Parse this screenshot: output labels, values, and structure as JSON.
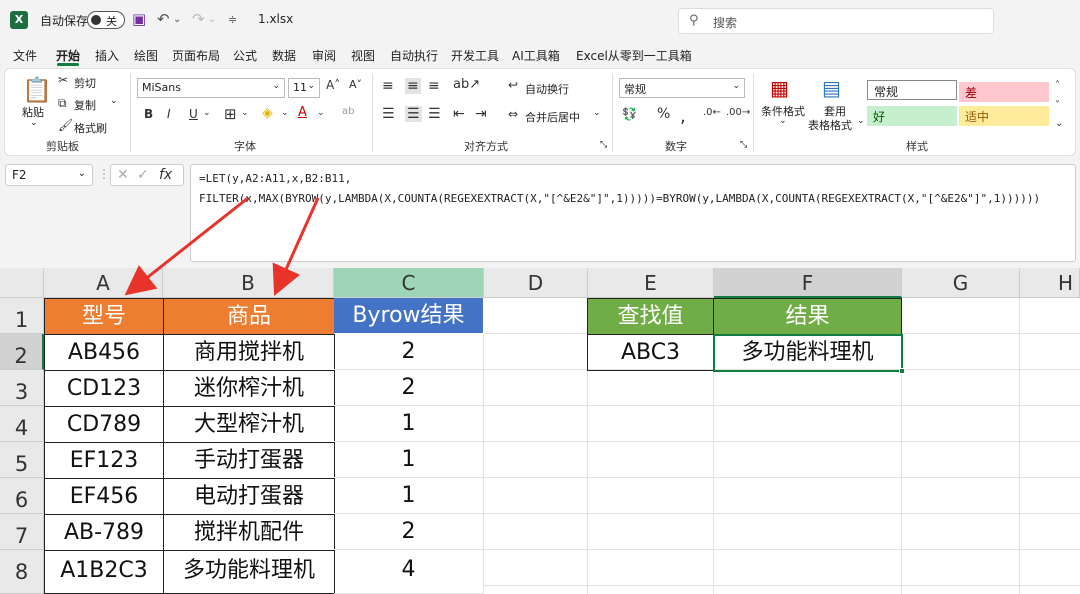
{
  "titlebar": {
    "autosave_label": "自动保存",
    "autosave_state": "关",
    "filename": "1.xlsx",
    "search_placeholder": "搜索"
  },
  "menu": [
    "文件",
    "开始",
    "插入",
    "绘图",
    "页面布局",
    "公式",
    "数据",
    "审阅",
    "视图",
    "自动执行",
    "开发工具",
    "AI工具箱",
    "Excel从零到一工具箱"
  ],
  "ribbon": {
    "clipboard": {
      "paste": "粘贴",
      "cut": "剪切",
      "copy": "复制",
      "format_painter": "格式刷",
      "group": "剪贴板"
    },
    "font": {
      "name": "MiSans",
      "size": "11",
      "group": "字体"
    },
    "alignment": {
      "wrap": "自动换行",
      "merge": "合并后居中",
      "group": "对齐方式"
    },
    "number": {
      "format": "常规",
      "group": "数字"
    },
    "styles": {
      "conditional": "条件格式",
      "table_line1": "套用",
      "table_line2": "表格格式",
      "normal": "常规",
      "bad": "差",
      "good": "好",
      "neutral": "适中",
      "group": "样式"
    }
  },
  "namebox": "F2",
  "formula_line1": "=LET(y,A2:A11,x,B2:B11,",
  "formula_line2": "FILTER(x,MAX(BYROW(y,LAMBDA(X,COUNTA(REGEXEXTRACT(X,\"[^&E2&\"]\",1)))))=BYROW(y,LAMBDA(X,COUNTA(REGEXEXTRACT(X,\"[^&E2&\"]\",1))))))",
  "columns": [
    "A",
    "B",
    "C",
    "D",
    "E",
    "F",
    "G",
    "H"
  ],
  "rows": [
    "1",
    "2",
    "3",
    "4",
    "5",
    "6",
    "7",
    "8"
  ],
  "table": {
    "headers": [
      "型号",
      "商品",
      "Byrow结果"
    ],
    "rows": [
      [
        "AB456",
        "商用搅拌机",
        "2"
      ],
      [
        "CD123",
        "迷你榨汁机",
        "2"
      ],
      [
        "CD789",
        "大型榨汁机",
        "1"
      ],
      [
        "EF123",
        "手动打蛋器",
        "1"
      ],
      [
        "EF456",
        "电动打蛋器",
        "1"
      ],
      [
        "AB-789",
        "搅拌机配件",
        "2"
      ],
      [
        "A1B2C3",
        "多功能料理机",
        "4"
      ]
    ]
  },
  "lookup": {
    "header_key": "查找值",
    "header_result": "结果",
    "key": "ABC3",
    "result": "多功能料理机"
  },
  "colors": {
    "orange": "#ed7d31",
    "blue": "#4472c4",
    "green": "#70ad47",
    "selection": "#107c41",
    "arrow": "#e8332a"
  }
}
